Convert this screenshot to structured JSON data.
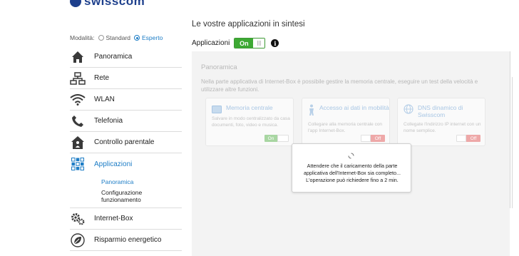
{
  "brand": {
    "logo_text": "swisscom"
  },
  "mode": {
    "label": "Modalità:",
    "options": [
      {
        "label": "Standard",
        "selected": false
      },
      {
        "label": "Esperto",
        "selected": true
      }
    ]
  },
  "sidebar": {
    "items": [
      {
        "label": "Panoramica",
        "icon": "home-icon"
      },
      {
        "label": "Rete",
        "icon": "network-icon"
      },
      {
        "label": "WLAN",
        "icon": "wifi-icon"
      },
      {
        "label": "Telefonia",
        "icon": "phone-icon"
      },
      {
        "label": "Controllo parentale",
        "icon": "parental-control-icon"
      },
      {
        "label": "Applicazioni",
        "icon": "apps-icon",
        "active": true,
        "subitems": [
          {
            "label": "Panoramica",
            "active": true
          },
          {
            "label": "Configurazione funzionamento",
            "active": false
          }
        ]
      },
      {
        "label": "Internet-Box",
        "icon": "gears-icon"
      },
      {
        "label": "Risparmio energetico",
        "icon": "leaf-icon"
      }
    ]
  },
  "main": {
    "title": "Le vostre applicazioni in sintesi",
    "apps_label": "Applicazioni",
    "apps_toggle": "On",
    "panel": {
      "title": "Panoramica",
      "description": "Nella parte applicativa di Internet-Box è possibile gestire la memoria centrale, eseguire un test della velocità e utilizzare altre funzioni.",
      "cards": [
        {
          "title": "Memoria centrale",
          "text": "Salvare in modo centralizzato da casa documenti, foto, video e musica.",
          "toggle": "On",
          "state": "on",
          "icon": "storage-icon"
        },
        {
          "title": "Accesso ai dati in mobilità",
          "text": "Collegare alla memoria centrale con l'app Internet-Box.",
          "toggle": "Off",
          "state": "off",
          "icon": "mobile-access-icon"
        },
        {
          "title": "DNS dinamico di Swisscom",
          "text": "Collegate l'indirizzo IP internet con un nome semplice.",
          "toggle": "Off",
          "state": "off",
          "icon": "globe-icon"
        }
      ]
    }
  },
  "dialog": {
    "message": "Attendere che il caricamento della parte applicativa dell'Internet-Box sia completo... L'operazione può richiedere fino a 2 min."
  },
  "colors": {
    "accent": "#1d7dc6",
    "toggle_on": "#3da933",
    "panel_bg": "#f3f3f3",
    "brand": "#1d3f8c"
  }
}
